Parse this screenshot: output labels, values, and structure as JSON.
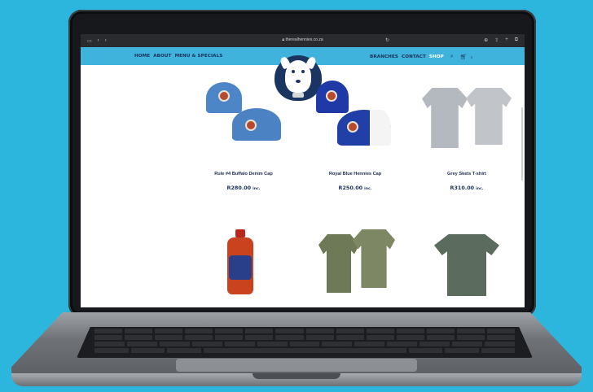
{
  "browser": {
    "url": "therealhennies.co.za"
  },
  "nav": {
    "left_links": [
      "HOME",
      "ABOUT",
      "MENU & SPECIALS"
    ],
    "right_links": [
      "BRANCHES",
      "CONTACT",
      "SHOP"
    ],
    "active_link": "SHOP",
    "cart_count": "0",
    "icons": [
      "search-icon",
      "cart-icon"
    ]
  },
  "colors": {
    "nav_bg": "#3fb3db",
    "nav_text": "#1b2f5a",
    "logo_bg": "#1b3563",
    "background": "#2cb6dd"
  },
  "products": [
    {
      "name": "Rule #4 Buffalo Denim Cap",
      "price": "R280.00",
      "price_suffix": "inc."
    },
    {
      "name": "Royal Blue Hennies Cap",
      "price": "R250.00",
      "price_suffix": "inc."
    },
    {
      "name": "Grey Skets T-shirt",
      "price": "R310.00",
      "price_suffix": "inc."
    },
    {
      "name": "",
      "price": "",
      "price_suffix": ""
    },
    {
      "name": "",
      "price": "",
      "price_suffix": ""
    },
    {
      "name": "",
      "price": "",
      "price_suffix": ""
    }
  ]
}
